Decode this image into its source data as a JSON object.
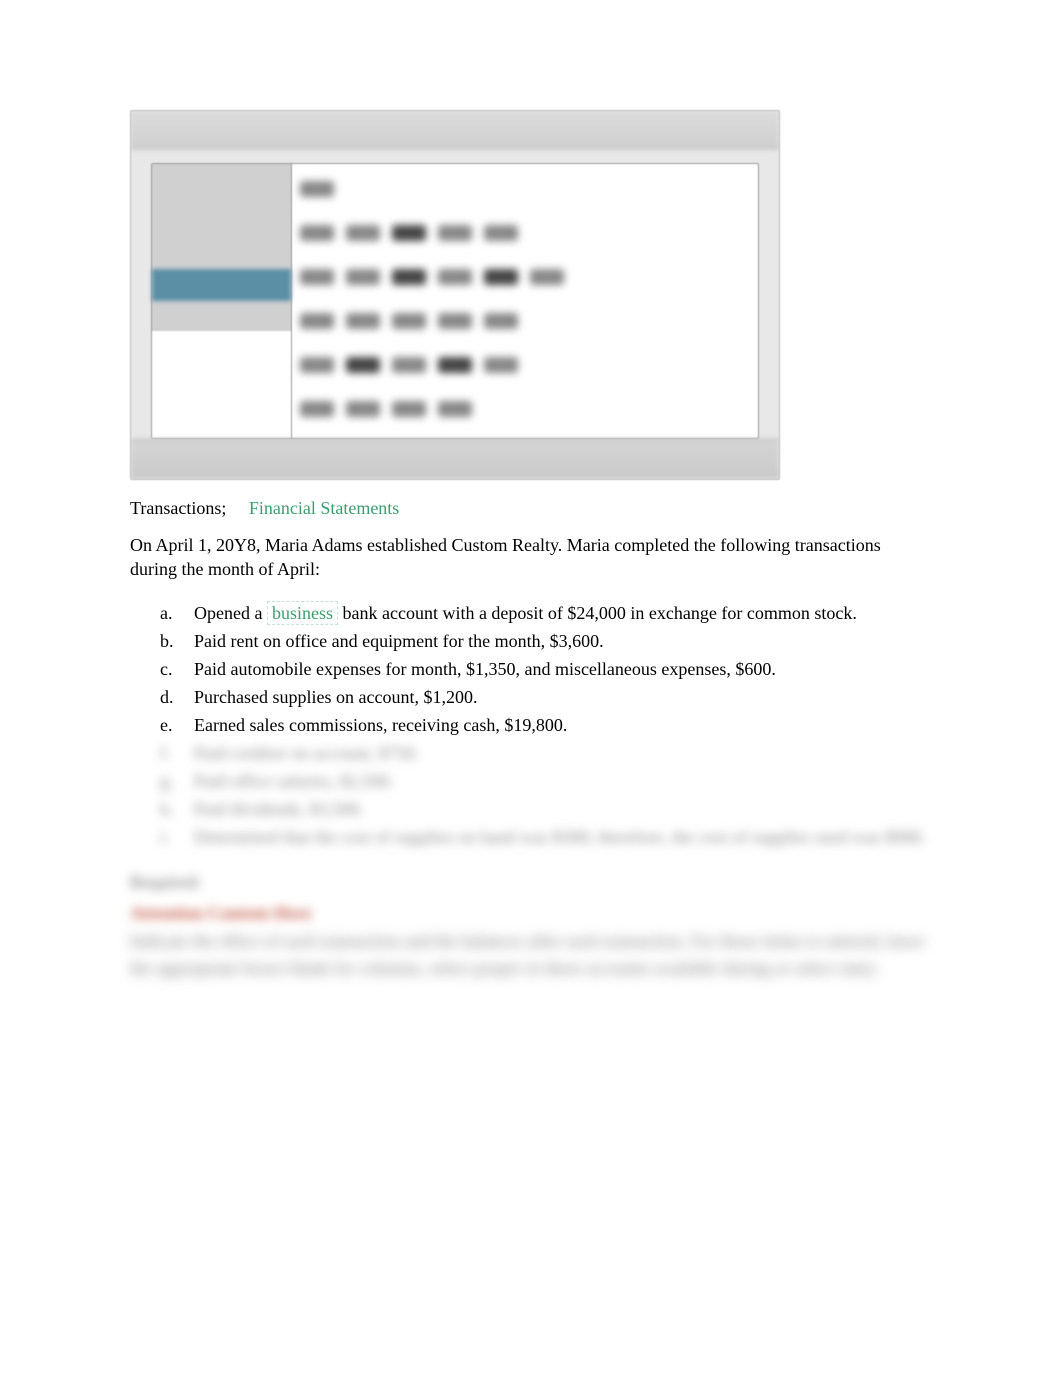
{
  "intro": {
    "transactions_label": "Transactions;",
    "fin_statements_label": "Financial Statements"
  },
  "paragraph": "On April 1, 20Y8, Maria Adams established Custom Realty. Maria completed the following transactions during the month of April:",
  "list_items": [
    {
      "letter": "a.",
      "pre": "Opened a ",
      "link": "business",
      "post": " bank account with a deposit of $24,000 in exchange for common stock.",
      "has_link": true,
      "blurred": false
    },
    {
      "letter": "b.",
      "text": "Paid rent on office and equipment for the month, $3,600.",
      "blurred": false
    },
    {
      "letter": "c.",
      "text": "Paid automobile expenses for month, $1,350, and miscellaneous expenses, $600.",
      "blurred": false
    },
    {
      "letter": "d.",
      "text": "Purchased supplies on account, $1,200.",
      "blurred": false
    },
    {
      "letter": "e.",
      "text": "Earned sales commissions, receiving cash, $19,800.",
      "blurred": false
    },
    {
      "letter": "f.",
      "text": "Paid creditor on account, $750.",
      "blurred": true
    },
    {
      "letter": "g.",
      "text": "Paid office salaries, $2,500.",
      "blurred": true
    },
    {
      "letter": "h.",
      "text": "Paid dividends, $3,500.",
      "blurred": true
    },
    {
      "letter": "i.",
      "text": "Determined that the cost of supplies on hand was $300; therefore, the cost of supplies used was $900.",
      "blurred": true
    }
  ],
  "hidden": {
    "required": "Required:",
    "red_heading": "Attention Content Here",
    "body": "Indicate the effect of each transaction and the balances after each transaction. For those items to entered, leave the appropriate boxes blank for columns, select proper in these accounts available during or select entry"
  }
}
